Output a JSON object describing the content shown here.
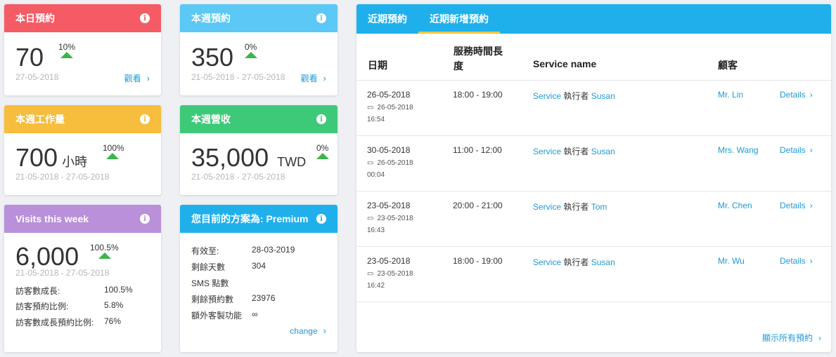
{
  "today": {
    "title": "本日預約",
    "value": "70",
    "pct": "10%",
    "date": "27-05-2018",
    "link": "觀看",
    "color": "#f55b64"
  },
  "week": {
    "title": "本週預約",
    "value": "350",
    "pct": "0%",
    "date": "21-05-2018 - 27-05-2018",
    "link": "觀看",
    "color": "#5bc8f5"
  },
  "workload": {
    "title": "本週工作量",
    "value": "700",
    "unit": "小時",
    "pct": "100%",
    "date": "21-05-2018 - 27-05-2018",
    "color": "#f7bd3c"
  },
  "revenue": {
    "title": "本週營收",
    "value": "35,000",
    "unit": "TWD",
    "pct": "0%",
    "date": "21-05-2018 - 27-05-2018",
    "color": "#3ec978"
  },
  "visits": {
    "title": "Visits this week",
    "value": "6,000",
    "pct": "100.5%",
    "date": "21-05-2018 - 27-05-2018",
    "color": "#b990d9",
    "stats": [
      {
        "label": "訪客數成長:",
        "value": "100.5%"
      },
      {
        "label": "訪客預約比例:",
        "value": "5.8%"
      },
      {
        "label": "訪客數成長預約比例:",
        "value": "76%"
      }
    ]
  },
  "plan": {
    "title": "您目前的方案為: Premium",
    "color": "#1fb0ec",
    "rows": [
      {
        "label": "有效至:",
        "value": "28-03-2019"
      },
      {
        "label": "剩餘天數",
        "value": "304"
      },
      {
        "label": "SMS 點數",
        "value": ""
      },
      {
        "label": "剩餘預約數",
        "value": "23976"
      },
      {
        "label": "額外客製功能",
        "value": "∞"
      }
    ],
    "link": "change"
  },
  "panel": {
    "tabs": [
      "近期預約",
      "近期新增預約"
    ],
    "headers": {
      "date": "日期",
      "duration": "服務時間長度",
      "service": "Service name",
      "customer": "顧客"
    },
    "rows": [
      {
        "date": "26-05-2018",
        "created": "26-05-2018",
        "time": "16:54",
        "slot": "18:00 - 19:00",
        "service": "Service",
        "exec": "執行者",
        "staff": "Susan",
        "customer": "Mr. Lin",
        "details": "Details"
      },
      {
        "date": "30-05-2018",
        "created": "26-05-2018",
        "time": "00:04",
        "slot": "11:00 - 12:00",
        "service": "Service",
        "exec": "執行者",
        "staff": "Susan",
        "customer": "Mrs. Wang",
        "details": "Details"
      },
      {
        "date": "23-05-2018",
        "created": "23-05-2018",
        "time": "16:43",
        "slot": "20:00 - 21:00",
        "service": "Service",
        "exec": "執行者",
        "staff": "Tom",
        "customer": "Mr. Chen",
        "details": "Details"
      },
      {
        "date": "23-05-2018",
        "created": "23-05-2018",
        "time": "16:42",
        "slot": "18:00 - 19:00",
        "service": "Service",
        "exec": "執行者",
        "staff": "Susan",
        "customer": "Mr. Wu",
        "details": "Details"
      }
    ],
    "show_all": "顯示所有預約"
  },
  "accent": {
    "up": "#3cb54a",
    "link": "#1e9ad6"
  }
}
